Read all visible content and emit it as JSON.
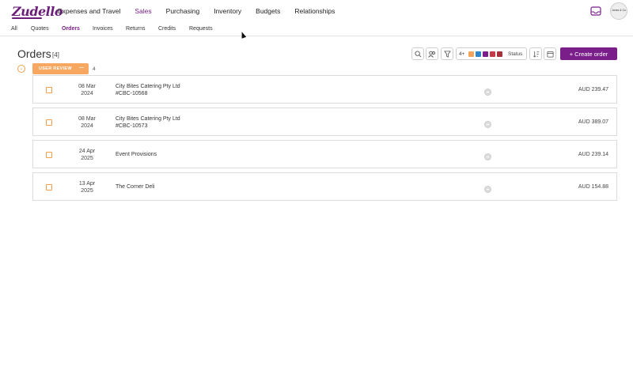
{
  "app": {
    "logo": "Zudello",
    "avatar_text": "Jones & Co"
  },
  "main_nav": [
    "Expenses and Travel",
    "Sales",
    "Purchasing",
    "Inventory",
    "Budgets",
    "Relationships"
  ],
  "main_nav_active": "Sales",
  "sub_nav": [
    "All",
    "Quotes",
    "Orders",
    "Invoices",
    "Returns",
    "Credits",
    "Requests"
  ],
  "sub_nav_active": "Orders",
  "page": {
    "title": "Orders",
    "count": "[4]"
  },
  "toolbar": {
    "status_plus": "4+",
    "status_label": "Status",
    "status_colors": [
      "#f5a55b",
      "#2f86c8",
      "#7a1f8a",
      "#c53a4a",
      "#a8303d"
    ],
    "create_label": "+ Create order",
    "icons": [
      "search-icon",
      "users-icon",
      "filter-icon",
      "sort-icon",
      "calendar-icon"
    ]
  },
  "group": {
    "label": "USER REVIEW",
    "dash": "—",
    "count": "4"
  },
  "orders": [
    {
      "date_line1": "08 Mar",
      "date_line2": "2024",
      "customer": "City Bites Catering Pty Ltd",
      "ref": "#CBC-10568",
      "amount": "AUD 239.47"
    },
    {
      "date_line1": "08 Mar",
      "date_line2": "2024",
      "customer": "City Bites Catering Pty Ltd",
      "ref": "#CBC-10573",
      "amount": "AUD 389.07"
    },
    {
      "date_line1": "24 Apr",
      "date_line2": "2025",
      "customer": "Event Provisions",
      "ref": "",
      "amount": "AUD 239.14"
    },
    {
      "date_line1": "13 Apr",
      "date_line2": "2025",
      "customer": "The Corner Deli",
      "ref": "",
      "amount": "AUD 154.88"
    }
  ]
}
